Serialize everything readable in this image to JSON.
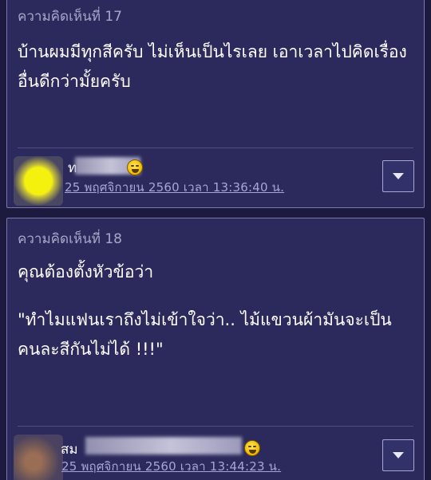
{
  "comments": [
    {
      "number_label": "ความคิดเห็นที่ 17",
      "body": [
        "บ้านผมมีทุกสีครับ ไม่เห็นเป็นไรเลย เอาเวลาไปคิดเรื่องอื่นดีกว่ามั้ยครับ"
      ],
      "user_name": "ท",
      "timestamp": "25 พฤศจิกายน 2560 เวลา 13:36:40 น."
    },
    {
      "number_label": "ความคิดเห็นที่ 18",
      "body": [
        "คุณต้องตั้งหัวข้อว่า",
        "\"ทำไมแฟนเราถึงไม่เข้าใจว่า.. ไม้แขวนผ้ามันจะเป็นคนละสีกันไม่ได้ !!!\""
      ],
      "user_name": "สม",
      "timestamp": "25 พฤศจิกายน 2560 เวลา 13:44:23 น."
    }
  ],
  "colors": {
    "background": "#1c1a3f",
    "card": "#2c2a5c",
    "timestamp": "#a7a5d8"
  }
}
